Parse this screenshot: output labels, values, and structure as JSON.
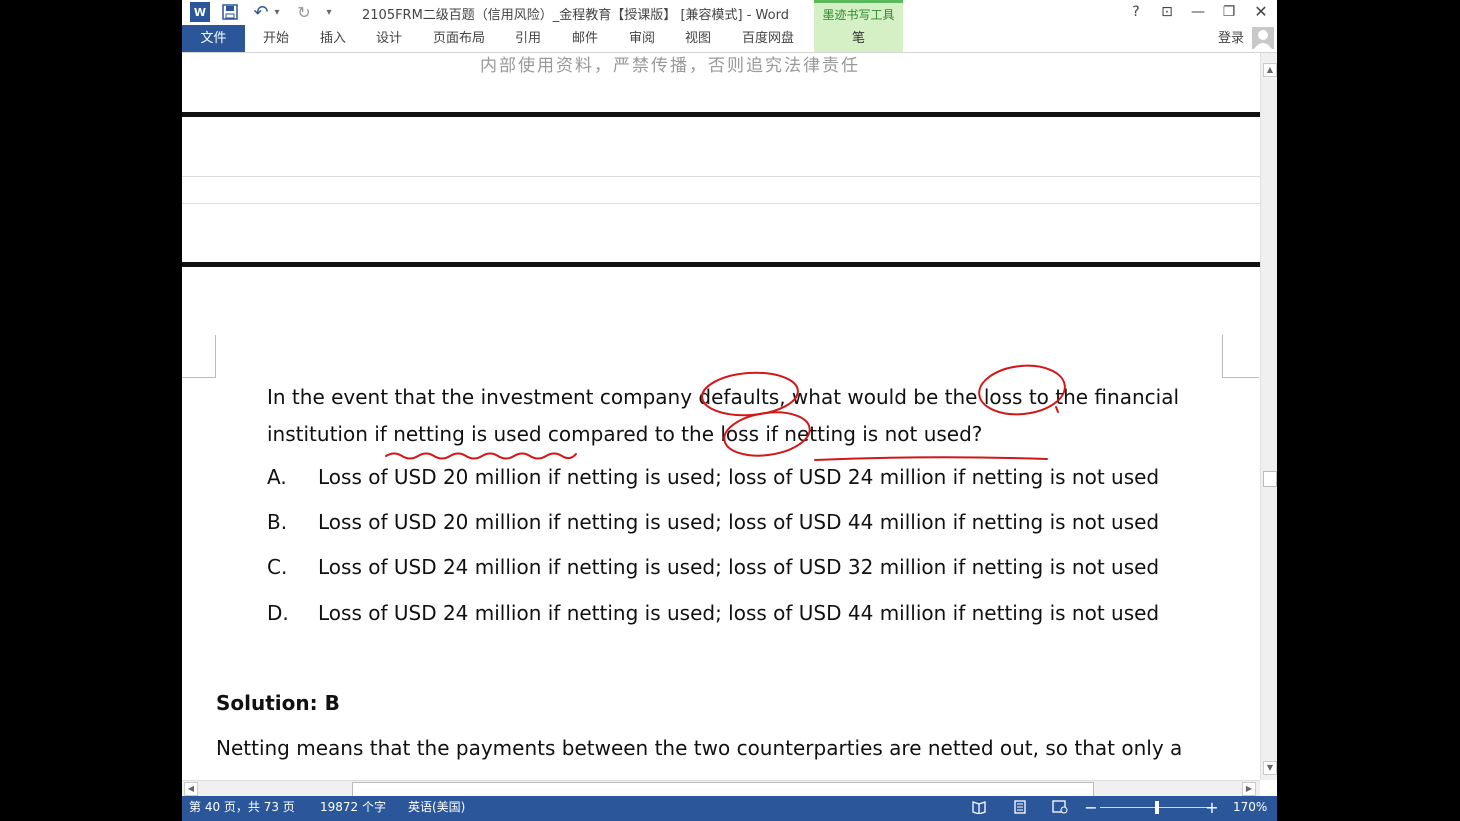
{
  "titlebar": {
    "doc_title": "2105FRM二级百题（信用风险）_金程教育【授课版】 [兼容模式] - Word",
    "ink_tools_label": "墨迹书写工具",
    "help": "?",
    "ribbon_display": "⊡",
    "minimize": "—",
    "restore": "❐",
    "close": "✕",
    "word_icon": "W",
    "save_icon": "💾",
    "undo_icon": "↶",
    "undo_drop": "▾",
    "redo_icon": "↻",
    "customize": "▾"
  },
  "ribbon": {
    "tabs": [
      "文件",
      "开始",
      "插入",
      "设计",
      "页面布局",
      "引用",
      "邮件",
      "审阅",
      "视图",
      "百度网盘",
      "笔"
    ],
    "login": "登录"
  },
  "document": {
    "watermark": "内部使用资料，严禁传播，否则追究法律责任",
    "question_line1": "In the event that the investment company defaults, what would be the loss to the financial",
    "question_line2": "institution if netting is used compared to the loss if netting is not used?",
    "options": [
      {
        "letter": "A.",
        "text": "Loss of USD 20 million if netting is used; loss of USD 24 million if netting is not used"
      },
      {
        "letter": "B.",
        "text": "Loss of USD 20 million if netting is used; loss of USD 44 million if netting is not used"
      },
      {
        "letter": "C.",
        "text": "Loss of USD 24 million if netting is used; loss of USD 32 million if netting is not used"
      },
      {
        "letter": "D.",
        "text": "Loss of USD 24 million if netting is used; loss of USD 44 million if netting is not used"
      }
    ],
    "solution_heading": "Solution: B",
    "solution_text": "Netting means that the payments between the two counterparties are netted out, so that only a"
  },
  "statusbar": {
    "page": "第 40 页，共 73 页",
    "words": "19872 个字",
    "language": "英语(美国)",
    "zoom_minus": "−",
    "zoom_plus": "+",
    "zoom": "170%",
    "zoom_level_percent": 51
  },
  "colors": {
    "accent": "#2b579a",
    "ink_tools": "#d5f0c5",
    "ink_annotation": "#d01818"
  }
}
